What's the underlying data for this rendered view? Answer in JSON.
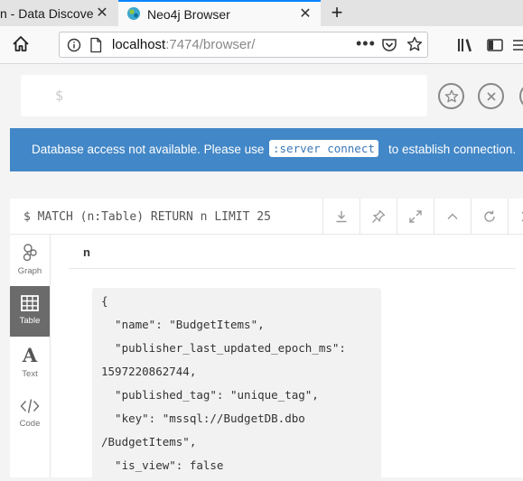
{
  "browser": {
    "tabs": [
      {
        "title": "n - Data Discove",
        "active": false
      },
      {
        "title": "Neo4j Browser",
        "active": true
      }
    ],
    "url": {
      "host": "localhost",
      "rest": ":7474/browser/"
    },
    "icons": [
      "home-icon",
      "info-icon",
      "lock-icon",
      "page-actions-icon",
      "pocket-icon",
      "bookmark-star-icon",
      "library-icon",
      "sidebar-icon"
    ]
  },
  "editor": {
    "prompt": "$"
  },
  "banner": {
    "text_before": "Database access not available. Please use",
    "command": ":server connect",
    "text_after": "to establish connection.",
    "color": "#4287c7"
  },
  "frame": {
    "query": "$ MATCH (n:Table) RETURN n LIMIT 25",
    "side_tabs": [
      {
        "label": "Graph",
        "active": false
      },
      {
        "label": "Table",
        "active": true
      },
      {
        "label": "Text",
        "active": false
      },
      {
        "label": "Code",
        "active": false
      }
    ],
    "column": "n",
    "json_lines": [
      "{",
      "  \"name\": \"BudgetItems\",",
      "  \"publisher_last_updated_epoch_ms\":",
      "1597220862744,",
      "  \"published_tag\": \"unique_tag\",",
      "  \"key\": \"mssql://BudgetDB.dbo",
      "/BudgetItems\",",
      "  \"is_view\": false"
    ]
  }
}
